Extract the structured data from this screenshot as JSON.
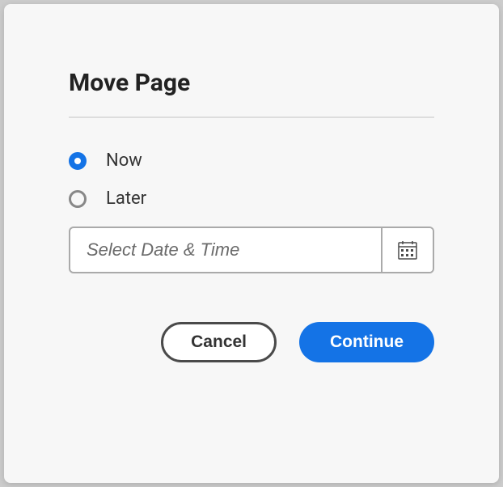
{
  "dialog": {
    "title": "Move Page",
    "options": {
      "now": "Now",
      "later": "Later",
      "selected": "now"
    },
    "dateInput": {
      "placeholder": "Select Date & Time",
      "value": ""
    },
    "buttons": {
      "cancel": "Cancel",
      "continue": "Continue"
    }
  }
}
